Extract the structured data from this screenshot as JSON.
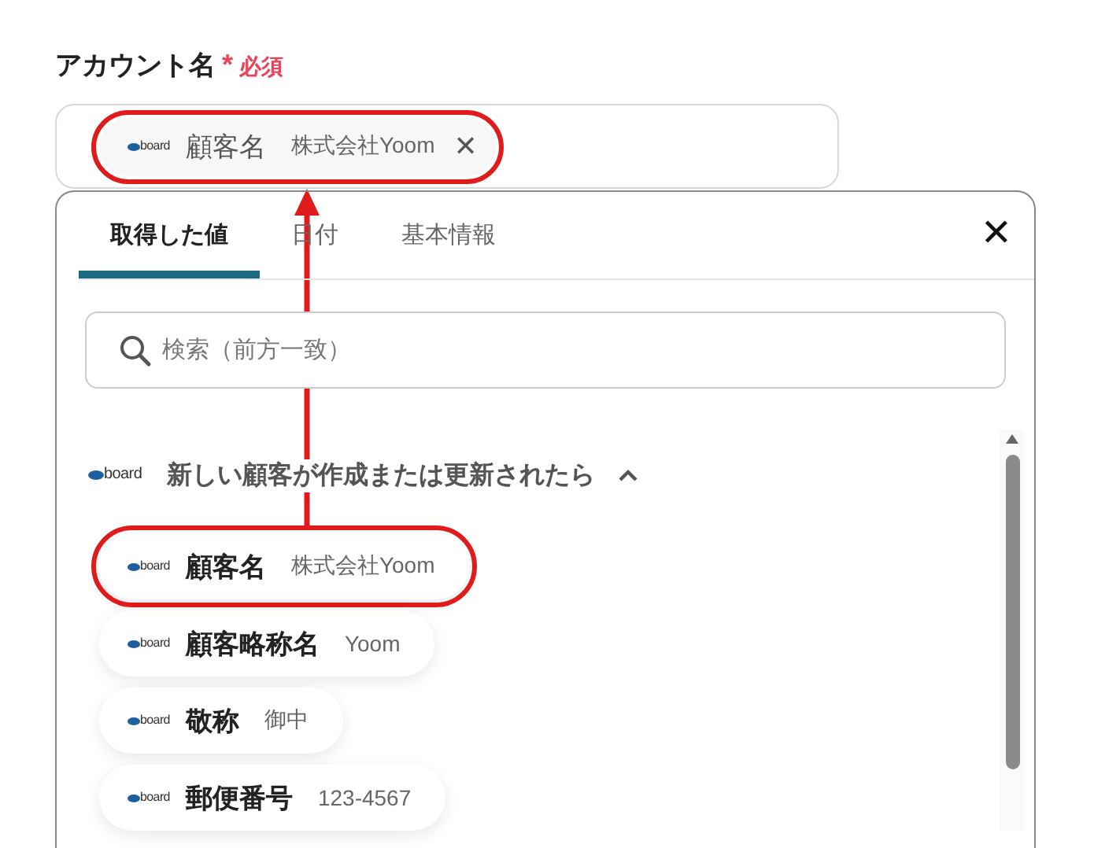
{
  "field": {
    "label": "アカウント名",
    "required_mark": "*",
    "required_text": "必須",
    "value_chip": {
      "logo": "board",
      "name": "顧客名",
      "value": "株式会社Yoom",
      "remove": "✕",
      "highlighted": true
    }
  },
  "panel": {
    "tabs": [
      {
        "label": "取得した値",
        "selected": true
      },
      {
        "label": "日付",
        "selected": false
      },
      {
        "label": "基本情報",
        "selected": false
      }
    ],
    "close": "✕",
    "search": {
      "placeholder": "検索（前方一致）"
    },
    "group": {
      "logo": "board",
      "title": "新しい顧客が作成または更新されたら",
      "expanded": true,
      "items": [
        {
          "logo": "board",
          "name": "顧客名",
          "value": "株式会社Yoom",
          "highlighted": true
        },
        {
          "logo": "board",
          "name": "顧客略称名",
          "value": "Yoom",
          "highlighted": false
        },
        {
          "logo": "board",
          "name": "敬称",
          "value": "御中",
          "highlighted": false
        },
        {
          "logo": "board",
          "name": "郵便番号",
          "value": "123-4567",
          "highlighted": false
        }
      ]
    }
  }
}
